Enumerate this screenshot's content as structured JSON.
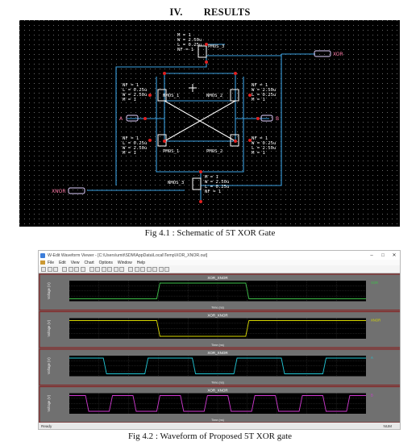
{
  "section": {
    "number": "IV.",
    "title": "RESULTS"
  },
  "schematic": {
    "instances": [
      {
        "name": "PMOS_3",
        "params": [
          "M = 1",
          "W = 2.50u",
          "L = 0.25u",
          "NF = 1"
        ]
      },
      {
        "name": "NMOS_1",
        "params": [
          "NF = 1",
          "L = 0.25u",
          "W = 2.50u",
          "M = 1"
        ]
      },
      {
        "name": "NMOS_2",
        "params": [
          "NF = 1",
          "W = 2.50u",
          "L = 0.25u",
          "M = 1"
        ]
      },
      {
        "name": "PMOS_1",
        "params": [
          "NF = 1",
          "L = 0.25u",
          "W = 2.50u",
          "M = 1"
        ]
      },
      {
        "name": "PMOS_2",
        "params": [
          "NF = 1",
          "W = 0.25u",
          "L = 2.50u",
          "M = 1"
        ]
      },
      {
        "name": "NMOS_3",
        "params": [
          "M = 1",
          "W = 2.50u",
          "L = 0.25u",
          "NF = 1"
        ]
      }
    ],
    "ports": {
      "a": "A",
      "b": "B",
      "xor": "XOR",
      "xnor": "XNOR"
    }
  },
  "caption1": "Fig 4.1 : Schematic of 5T XOR Gate",
  "waveform": {
    "title": "W-Edit Waveform Viewer - [C:\\Users\\umit\\SDM\\AppData\\Local\\Temp\\XOR_XNOR.out]",
    "menu": [
      "File",
      "Edit",
      "View",
      "Chart",
      "Options",
      "Window",
      "Help"
    ],
    "panels": [
      {
        "title": "XOR_XNOR",
        "ylabel": "Voltage (V)",
        "xlabel": "Time (ns)",
        "color": "#3ec04a",
        "legend": "XOR"
      },
      {
        "title": "XOR_XNOR",
        "ylabel": "Voltage (V)",
        "xlabel": "Time (ns)",
        "color": "#d8d800",
        "legend": "XNOR"
      },
      {
        "title": "XOR_XNOR",
        "ylabel": "Voltage (V)",
        "xlabel": "Time (ns)",
        "color": "#22c7d6",
        "legend": "A"
      },
      {
        "title": "XOR_XNOR",
        "ylabel": "Voltage (V)",
        "xlabel": "Time (ns)",
        "color": "#d23ad3",
        "legend": "B"
      }
    ],
    "status_left": "Ready",
    "status_right": "NUM"
  },
  "caption2": "Fig 4.2 : Waveform of  Proposed 5T XOR gate"
}
